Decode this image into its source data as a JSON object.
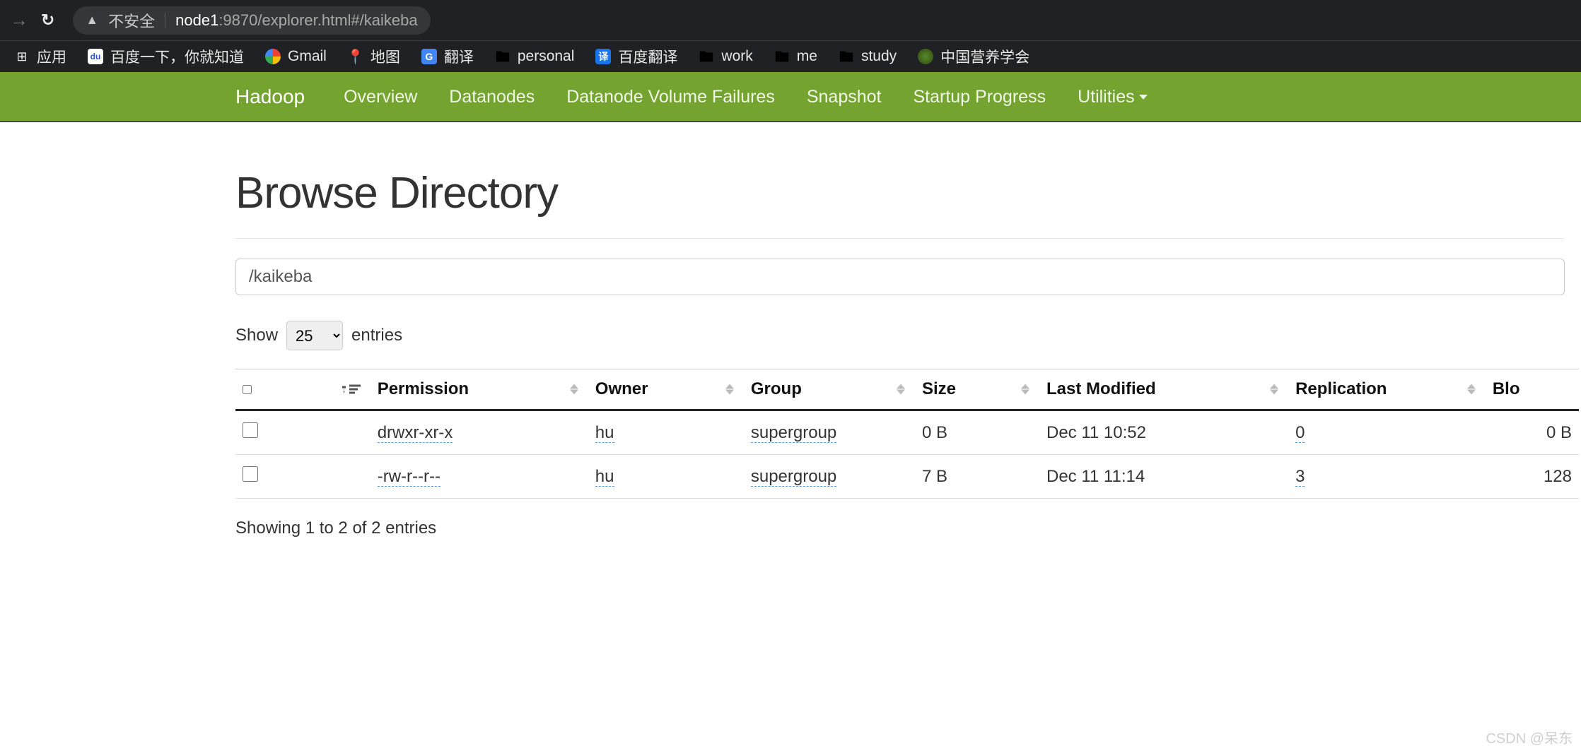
{
  "chrome": {
    "not_secure_label": "不安全",
    "url_host": "node1",
    "url_rest": ":9870/explorer.html#/kaikeba"
  },
  "bookmarks": {
    "apps": "应用",
    "baidu": "百度一下，你就知道",
    "gmail": "Gmail",
    "map": "地图",
    "translate": "翻译",
    "personal": "personal",
    "baidu_trans": "百度翻译",
    "work": "work",
    "me": "me",
    "study": "study",
    "nutrition": "中国营养学会"
  },
  "nav": {
    "brand": "Hadoop",
    "overview": "Overview",
    "datanodes": "Datanodes",
    "dvf": "Datanode Volume Failures",
    "snapshot": "Snapshot",
    "startup": "Startup Progress",
    "utilities": "Utilities"
  },
  "page": {
    "title": "Browse Directory",
    "path_value": "/kaikeba",
    "show_label": "Show",
    "entries_label": "entries",
    "page_size": "25",
    "showing_text": "Showing 1 to 2 of 2 entries"
  },
  "table": {
    "headers": {
      "permission": "Permission",
      "owner": "Owner",
      "group": "Group",
      "size": "Size",
      "last_modified": "Last Modified",
      "replication": "Replication",
      "block": "Blo"
    },
    "rows": [
      {
        "permission": "drwxr-xr-x",
        "owner": "hu",
        "group": "supergroup",
        "size": "0 B",
        "last_modified": "Dec 11 10:52",
        "replication": "0",
        "block": "0 B"
      },
      {
        "permission": "-rw-r--r--",
        "owner": "hu",
        "group": "supergroup",
        "size": "7 B",
        "last_modified": "Dec 11 11:14",
        "replication": "3",
        "block": "128"
      }
    ]
  },
  "watermark": "CSDN @呆东"
}
